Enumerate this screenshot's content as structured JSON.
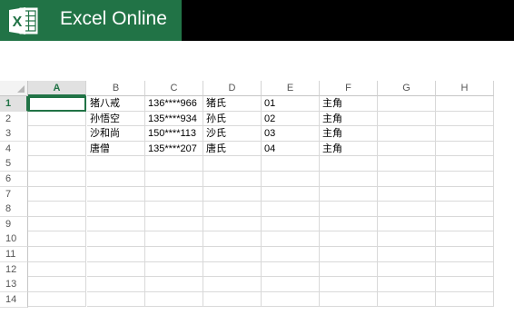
{
  "app": {
    "title": "Excel Online",
    "brand_color": "#217346",
    "icon": "excel-logo-icon",
    "icon_letter": "X"
  },
  "sheet": {
    "columns": [
      "A",
      "B",
      "C",
      "D",
      "E",
      "F",
      "G",
      "H"
    ],
    "rows": [
      "1",
      "2",
      "3",
      "4",
      "5",
      "6",
      "7",
      "8",
      "9",
      "10",
      "11",
      "12",
      "13",
      "14"
    ],
    "active_column": "A",
    "active_row": "1",
    "selected_cell": "A1",
    "cells": [
      [
        "",
        "猪八戒",
        "136****966",
        "猪氏",
        "01",
        "主角",
        "",
        ""
      ],
      [
        "",
        "孙悟空",
        "135****934",
        "孙氏",
        "02",
        "主角",
        "",
        ""
      ],
      [
        "",
        "沙和尚",
        "150****113",
        "沙氏",
        "03",
        "主角",
        "",
        ""
      ],
      [
        "",
        "唐僧",
        "135****207",
        "唐氏",
        "04",
        "主角",
        "",
        ""
      ]
    ]
  }
}
